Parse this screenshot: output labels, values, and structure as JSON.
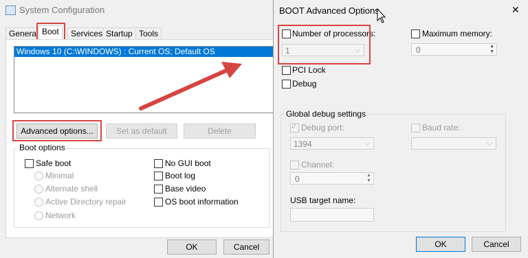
{
  "main_window": {
    "title": "System Configuration",
    "tabs": [
      "General",
      "Boot",
      "Services",
      "Startup",
      "Tools"
    ],
    "os_entry": "Windows 10 (C:\\WINDOWS) : Current OS; Default OS",
    "buttons": {
      "advanced": "Advanced options...",
      "set_default": "Set as default",
      "delete": "Delete"
    },
    "boot_options_title": "Boot options",
    "boot_options": {
      "safe_boot": "Safe boot",
      "minimal": "Minimal",
      "alt_shell": "Alternate shell",
      "ad_repair": "Active Directory repair",
      "network": "Network",
      "no_gui": "No GUI boot",
      "boot_log": "Boot log",
      "base_video": "Base video",
      "os_info": "OS boot information"
    },
    "ok": "OK",
    "cancel": "Cancel"
  },
  "advanced_dialog": {
    "title": "BOOT Advanced Options",
    "close_symbol": "✕",
    "num_processors_label": "Number of processors:",
    "num_processors_value": "1",
    "max_memory_label": "Maximum memory:",
    "max_memory_value": "0",
    "pci_lock": "PCI Lock",
    "debug": "Debug",
    "global_debug_title": "Global debug settings",
    "debug_port_label": "Debug port:",
    "debug_port_value": "1394",
    "baud_rate_label": "Baud rate:",
    "channel_label": "Channel:",
    "channel_value": "0",
    "usb_target_label": "USB target name:",
    "ok": "OK",
    "cancel": "Cancel"
  },
  "colors": {
    "highlight": "#0078d7",
    "annotation": "#d64541"
  }
}
